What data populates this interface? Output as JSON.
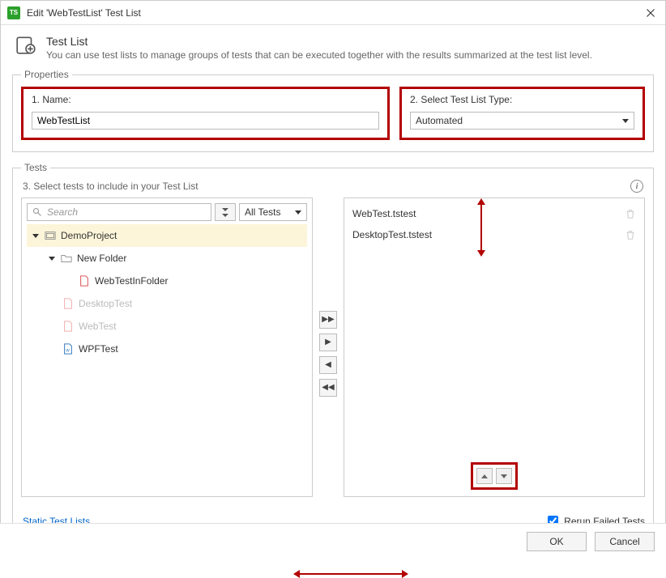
{
  "window": {
    "title": "Edit 'WebTestList' Test List"
  },
  "header": {
    "title": "Test List",
    "description": "You can use test lists to manage groups of tests that can be executed together with the results summarized at the test list level."
  },
  "properties": {
    "legend": "Properties",
    "name_label": "1. Name:",
    "name_value": "WebTestList",
    "type_label": "2. Select Test List Type:",
    "type_value": "Automated"
  },
  "tests": {
    "legend": "Tests",
    "subhead": "3. Select tests to include in your Test List",
    "search_placeholder": "Search",
    "filter_label": "All Tests",
    "tree": {
      "root": "DemoProject",
      "folder": "New Folder",
      "items": [
        {
          "label": "WebTestInFolder",
          "dim": false,
          "color": "#e05a5a"
        },
        {
          "label": "DesktopTest",
          "dim": true,
          "color": "#e05a5a"
        },
        {
          "label": "WebTest",
          "dim": true,
          "color": "#e05a5a"
        },
        {
          "label": "WPFTest",
          "dim": false,
          "color": "#3a7fc4"
        }
      ]
    },
    "selected": [
      "WebTest.tstest",
      "DesktopTest.tstest"
    ]
  },
  "link_label": "Static Test Lists",
  "rerun_label": "Rerun Failed Tests",
  "rerun_checked": true,
  "buttons": {
    "ok": "OK",
    "cancel": "Cancel"
  }
}
